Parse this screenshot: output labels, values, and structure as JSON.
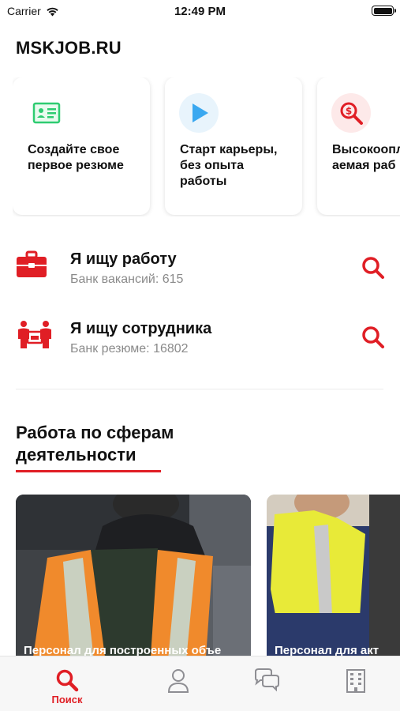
{
  "status_bar": {
    "carrier": "Carrier",
    "time": "12:49 PM"
  },
  "brand": "MSKJOB.RU",
  "cards": [
    {
      "label": "Создайте свое\nпервое резюме",
      "icon": "id-card-icon"
    },
    {
      "label": "Старт карьеры,\nбез опыта\nработы",
      "icon": "play-icon"
    },
    {
      "label": "Высокоопл\nаемая раб",
      "icon": "money-search-icon"
    }
  ],
  "rows": [
    {
      "title": "Я ищу работу",
      "subtitle": "Банк вакансий: 615",
      "icon": "briefcase-icon"
    },
    {
      "title": "Я ищу сотрудника",
      "subtitle": "Банк резюме: 16802",
      "icon": "team-icon"
    }
  ],
  "section": {
    "title": "Работа по сферам\nдеятельности"
  },
  "categories": [
    {
      "caption": "Персонал для построенных объе"
    },
    {
      "caption": "Персонал для акт"
    }
  ],
  "tabbar": {
    "search_label": "Поиск"
  },
  "colors": {
    "accent": "#e01e25",
    "green": "#2ecc71",
    "blue": "#3aa8f0"
  }
}
